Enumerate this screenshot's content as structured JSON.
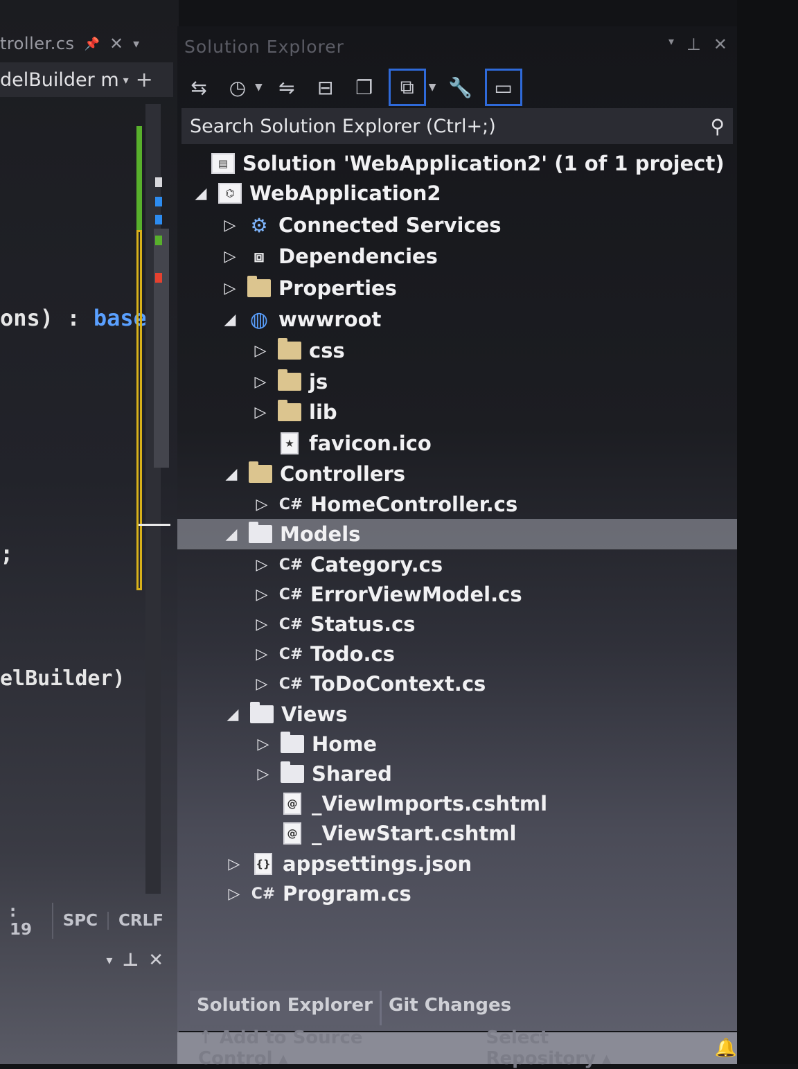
{
  "editor": {
    "tab_title": "troller.cs",
    "tab_pin": "📌",
    "tab_close": "✕",
    "tab_dropdown": "▾",
    "nav_member": "delBuilder m",
    "nav_dropdown": "▾",
    "nav_split": "+",
    "code_line_1_text": "ons) : ",
    "code_line_1_keyword": "base(",
    "code_line_2": ";",
    "code_line_3": "elBuilder)",
    "status_items": [
      ": 19",
      "SPC",
      "CRLF"
    ],
    "lower_pane_buttons": [
      "▾",
      "⊥",
      "✕"
    ]
  },
  "solution_explorer": {
    "title": "Solution Explorer",
    "title_buttons": [
      "▾",
      "⊥",
      "✕"
    ],
    "search_placeholder": "Search Solution Explorer (Ctrl+;)",
    "search_icon": "🔍",
    "tree": [
      {
        "label": "Solution 'WebApplication2' (1 of 1 project)",
        "icon": "solution-icon",
        "arrow": ""
      },
      {
        "label": "WebApplication2",
        "icon": "project-icon",
        "arrow": "◢"
      },
      {
        "label": "Connected Services",
        "icon": "connected-services-icon",
        "arrow": "▷"
      },
      {
        "label": "Dependencies",
        "icon": "dependencies-icon",
        "arrow": "▷"
      },
      {
        "label": "Properties",
        "icon": "properties-icon",
        "arrow": "▷"
      },
      {
        "label": "wwwroot",
        "icon": "globe-icon",
        "arrow": "◢"
      },
      {
        "label": "css",
        "icon": "folder-icon",
        "arrow": "▷"
      },
      {
        "label": "js",
        "icon": "folder-icon",
        "arrow": "▷"
      },
      {
        "label": "lib",
        "icon": "folder-icon",
        "arrow": "▷"
      },
      {
        "label": "favicon.ico",
        "icon": "file-icon",
        "arrow": ""
      },
      {
        "label": "Controllers",
        "icon": "folder-icon",
        "arrow": "◢"
      },
      {
        "label": "HomeController.cs",
        "icon": "csharp-icon",
        "arrow": "▷"
      },
      {
        "label": "Models",
        "icon": "folder-icon",
        "arrow": "◢"
      },
      {
        "label": "Category.cs",
        "icon": "csharp-icon",
        "arrow": "▷"
      },
      {
        "label": "ErrorViewModel.cs",
        "icon": "csharp-icon",
        "arrow": "▷"
      },
      {
        "label": "Status.cs",
        "icon": "csharp-icon",
        "arrow": "▷"
      },
      {
        "label": "Todo.cs",
        "icon": "csharp-icon",
        "arrow": "▷"
      },
      {
        "label": "ToDoContext.cs",
        "icon": "csharp-icon",
        "arrow": "▷"
      },
      {
        "label": "Views",
        "icon": "folder-icon",
        "arrow": "◢"
      },
      {
        "label": "Home",
        "icon": "folder-icon",
        "arrow": "▷"
      },
      {
        "label": "Shared",
        "icon": "folder-icon",
        "arrow": "▷"
      },
      {
        "label": "_ViewImports.cshtml",
        "icon": "razor-file-icon",
        "arrow": ""
      },
      {
        "label": "_ViewStart.cshtml",
        "icon": "razor-file-icon",
        "arrow": ""
      },
      {
        "label": "appsettings.json",
        "icon": "json-file-icon",
        "arrow": "▷"
      },
      {
        "label": "Program.cs",
        "icon": "csharp-icon",
        "arrow": "▷"
      }
    ],
    "selected_item": "Models",
    "csharp_glyph": "C#",
    "tabs": [
      "Solution Explorer",
      "Git Changes"
    ]
  },
  "status_bar": {
    "add_to_source_control": "↑ Add to Source Control ▴",
    "select_repository": "Select Repository ▴",
    "bell_icon": "🔔"
  },
  "colors": {
    "accent": "#2f6ad9",
    "keyword": "#5aa0ff",
    "gutter_green": "#58b02c",
    "gutter_yellow": "#d8b11a",
    "folder": "#dcc58f"
  }
}
